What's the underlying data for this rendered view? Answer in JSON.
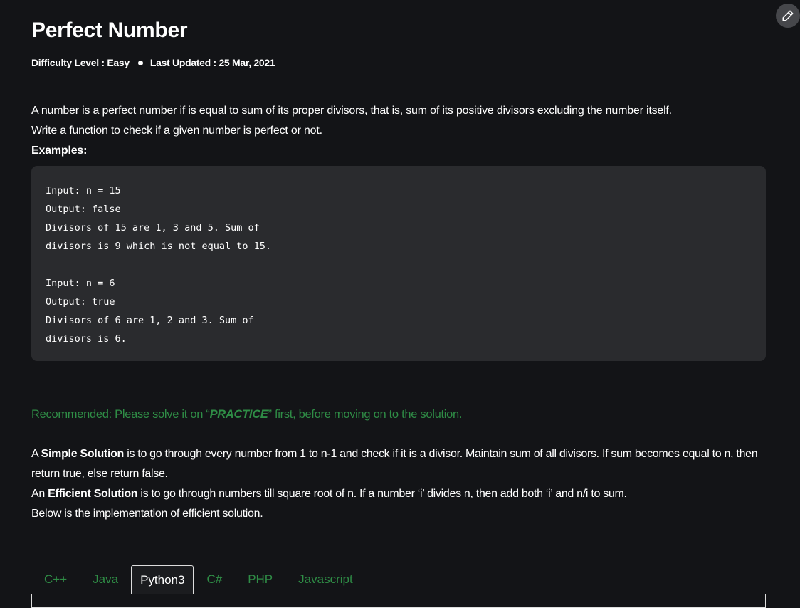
{
  "title": "Perfect Number",
  "meta": {
    "difficulty": "Difficulty Level : Easy",
    "updated": "Last Updated : 25 Mar, 2021"
  },
  "intro": {
    "line1": "A number is a perfect number if is equal to sum of its proper divisors, that is, sum of its positive divisors excluding the number itself.",
    "line2": "Write a function to check if a given number is perfect or not.",
    "examples": "Examples:"
  },
  "code_example": "Input: n = 15\nOutput: false\nDivisors of 15 are 1, 3 and 5. Sum of\ndivisors is 9 which is not equal to 15.\n\nInput: n = 6\nOutput: true\nDivisors of 6 are 1, 2 and 3. Sum of\ndivisors is 6.",
  "recommended": {
    "pre": "Recommended: Please solve it on “",
    "link": "PRACTICE",
    "post": "” first, before moving on to the solution."
  },
  "solution": {
    "p1_a": "A ",
    "p1_bold": "Simple Solution",
    "p1_b": " is to go through every number from 1 to n-1 and check if it is a divisor. Maintain sum of all divisors. If sum becomes equal to n, then return true, else return false.",
    "p2_a": "An ",
    "p2_bold": "Efficient Solution",
    "p2_b": " is to go through numbers till square root of n. If a number ‘i’ divides n, then add both ‘i’ and n/i to sum.",
    "p3": "Below is the implementation of efficient solution."
  },
  "tabs": [
    {
      "label": "C++"
    },
    {
      "label": "Java"
    },
    {
      "label": "Python3"
    },
    {
      "label": "C#"
    },
    {
      "label": "PHP"
    },
    {
      "label": "Javascript"
    }
  ],
  "active_tab": "Python3",
  "colors": {
    "accent": "#2f8d46",
    "background": "#131417",
    "code_bg": "#2a2b2e"
  },
  "icons": {
    "edit": "pencil-icon"
  }
}
